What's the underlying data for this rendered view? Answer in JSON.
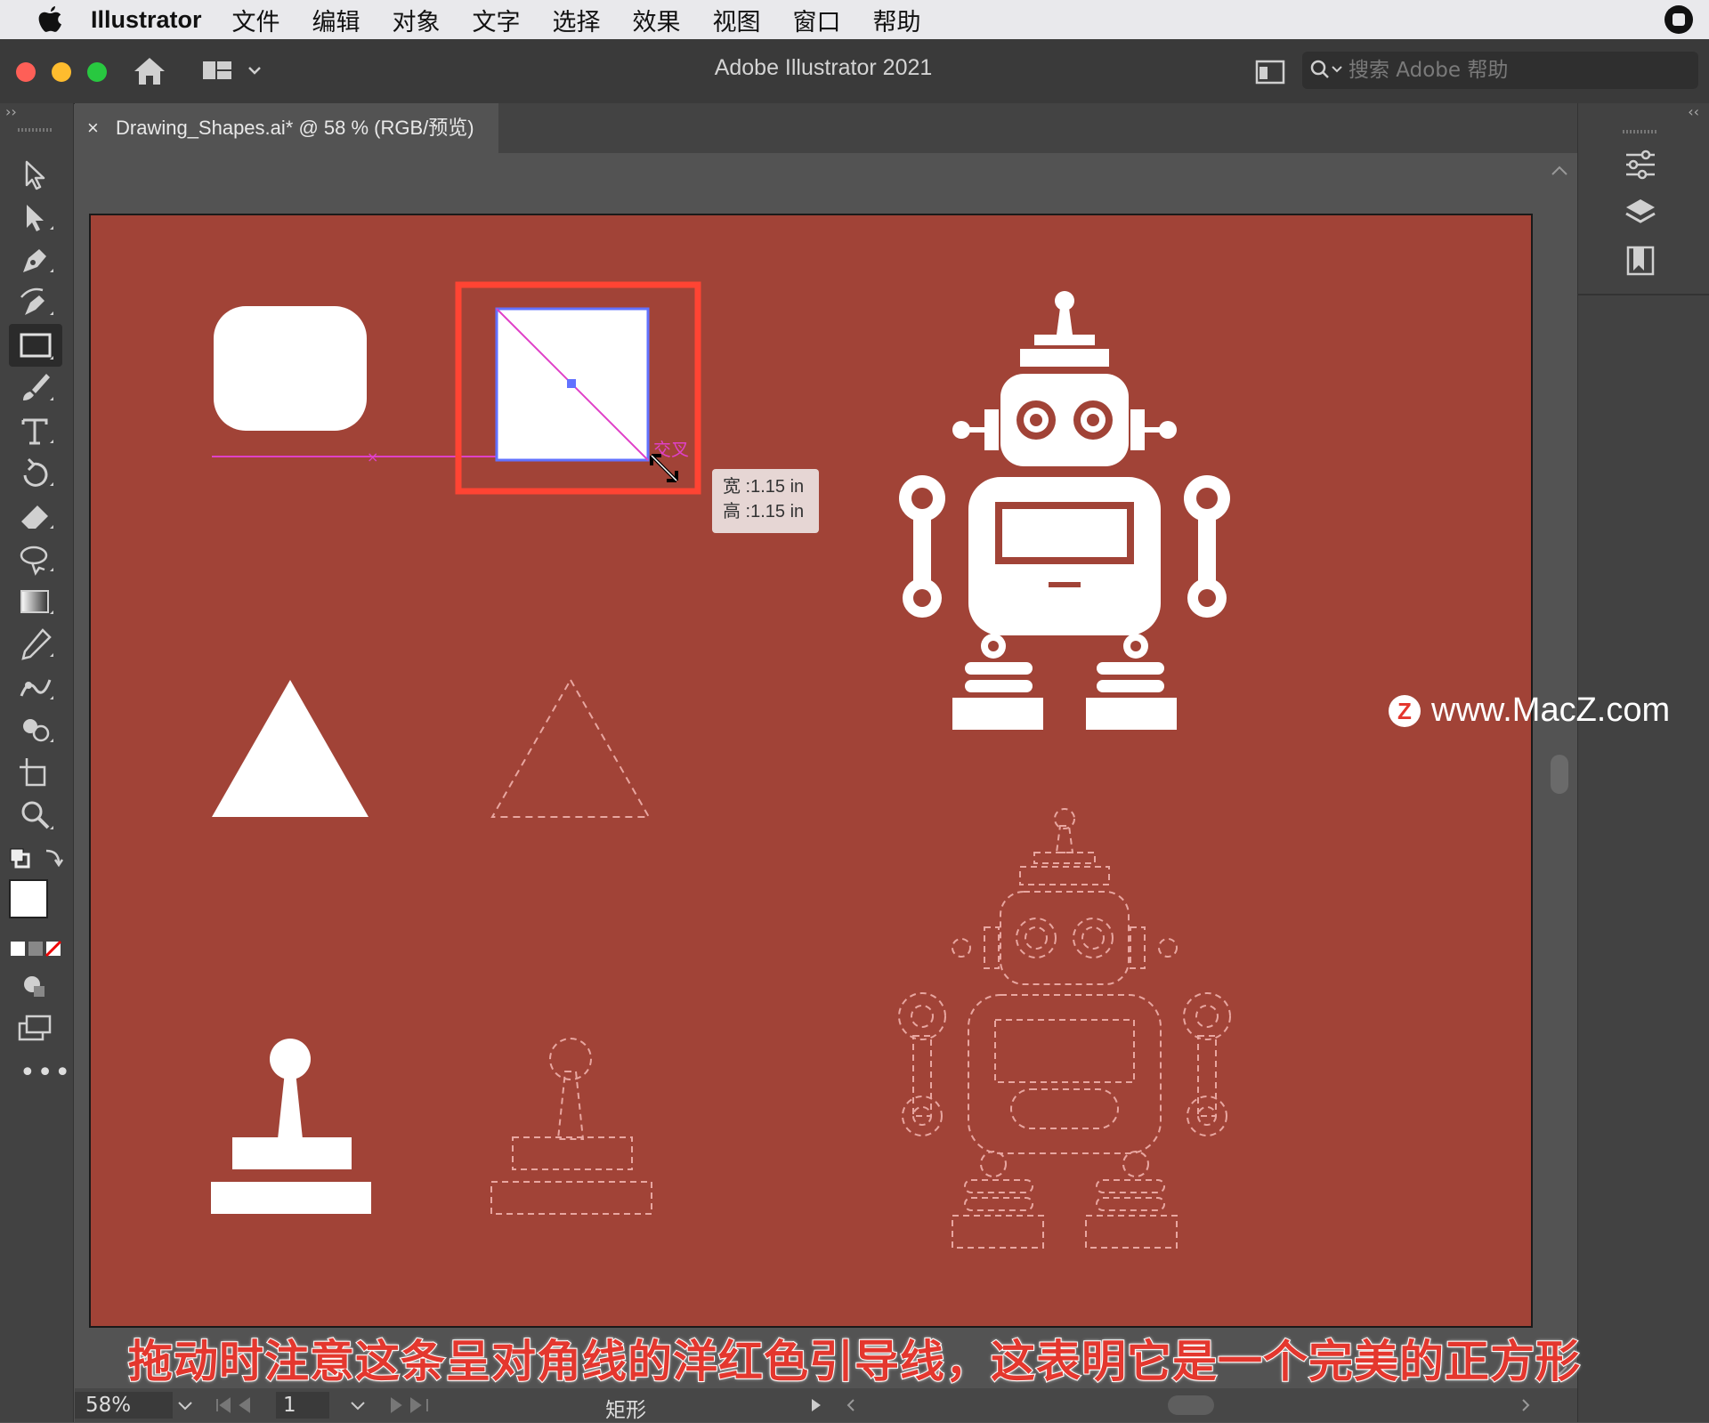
{
  "menubar": {
    "app": "Illustrator",
    "items": [
      "文件",
      "编辑",
      "对象",
      "文字",
      "选择",
      "效果",
      "视图",
      "窗口",
      "帮助"
    ]
  },
  "titlebar": {
    "title": "Adobe Illustrator 2021",
    "search_placeholder": "搜索 Adobe 帮助"
  },
  "tab": {
    "close": "×",
    "label": "Drawing_Shapes.ai* @ 58 % (RGB/预览)"
  },
  "canvas": {
    "artboard_color": "#a14337",
    "smart_guide_label": "交叉",
    "tooltip": {
      "width": "宽 :1.15 in",
      "height": "高 :1.15 in"
    },
    "highlight_color": "#ff4433",
    "guide_color": "#e040c8"
  },
  "status": {
    "zoom": "58%",
    "page": "1",
    "tool_name": "矩形"
  },
  "watermark": {
    "logo": "Z",
    "text": "www.MacZ.com"
  },
  "subtitle": "拖动时注意这条呈对角线的洋红色引导线，这表明它是一个完美的正方形",
  "toolbar_icons": [
    "selection-tool-icon",
    "direct-selection-tool-icon",
    "pen-tool-icon",
    "curvature-tool-icon",
    "rectangle-tool-icon",
    "paintbrush-tool-icon",
    "type-tool-icon",
    "rotate-tool-icon",
    "eraser-tool-icon",
    "lasso-tool-icon",
    "gradient-tool-icon",
    "eyedropper-tool-icon",
    "puppet-warp-tool-icon",
    "shape-builder-tool-icon",
    "artboard-tool-icon",
    "zoom-tool-icon"
  ]
}
